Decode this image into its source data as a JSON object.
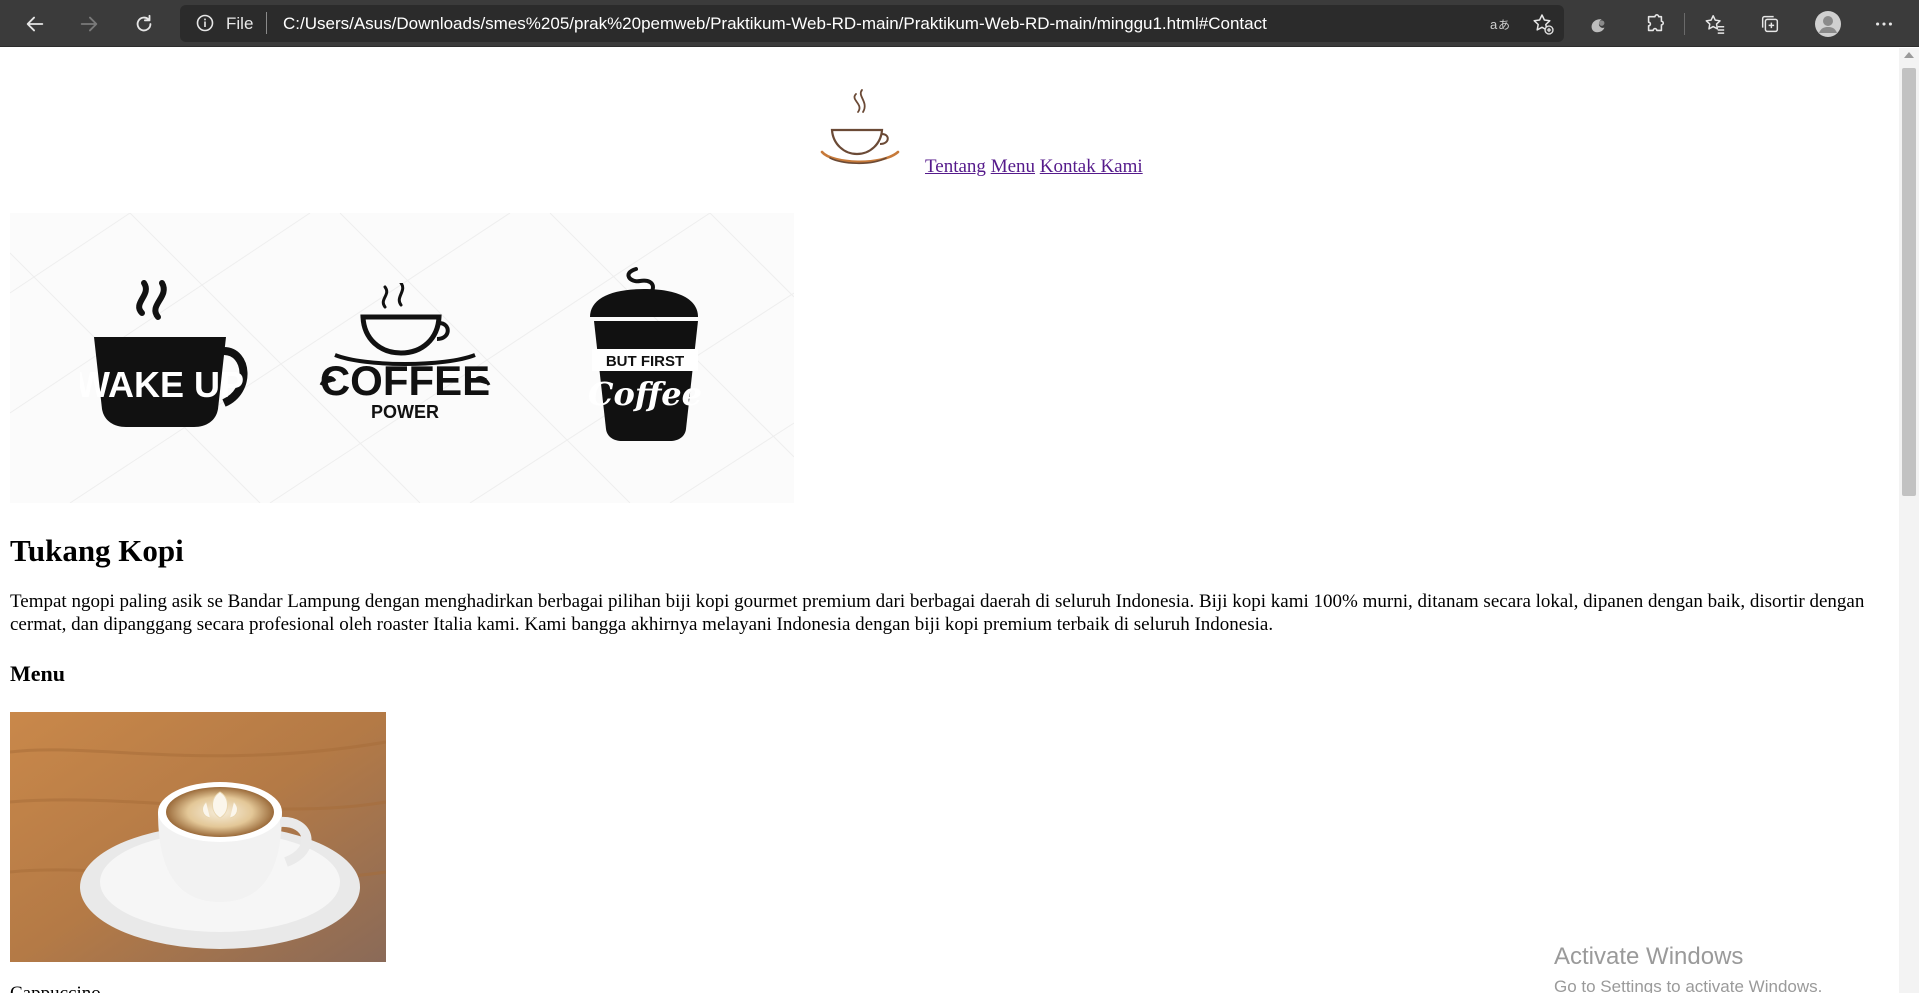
{
  "browser": {
    "scheme_label": "File",
    "url": "C:/Users/Asus/Downloads/smes%205/prak%20pemweb/Praktikum-Web-RD-main/Praktikum-Web-RD-main/minggu1.html#Contact",
    "icons": [
      "back-icon",
      "forward-icon",
      "refresh-icon",
      "info-icon",
      "read-aloud-icon",
      "add-favorite-icon",
      "shield-icon",
      "extensions-icon",
      "favorites-icon",
      "collections-icon",
      "profile-icon",
      "more-icon"
    ]
  },
  "page": {
    "nav": {
      "links": [
        "Tentang",
        "Menu",
        "Kontak Kami"
      ]
    },
    "banner": {
      "wake_text": "WAKE UP",
      "coffee_text": "COFFEE",
      "power_text": "POWER",
      "but_first_text": "BUT FIRST",
      "coffee_script_text": "Coffee"
    },
    "title": "Tukang Kopi",
    "description": "Tempat ngopi paling asik se Bandar Lampung dengan menghadirkan berbagai pilihan biji kopi gourmet premium dari berbagai daerah di seluruh Indonesia. Biji kopi kami 100% murni, ditanam secara lokal, dipanen dengan baik, disortir dengan cermat, dan dipanggang secara profesional oleh roaster Italia kami. Kami bangga akhirnya melayani Indonesia dengan biji kopi premium terbaik di seluruh Indonesia.",
    "menu_heading": "Menu",
    "next_item_text": "Cappuccino"
  },
  "overlay": {
    "activate_title": "Activate Windows",
    "activate_sub": "Go to Settings to activate Windows."
  },
  "colors": {
    "toolbar": "#3b3b3b",
    "address_bar": "#2b2b2b",
    "link_visited": "#551a8b"
  }
}
